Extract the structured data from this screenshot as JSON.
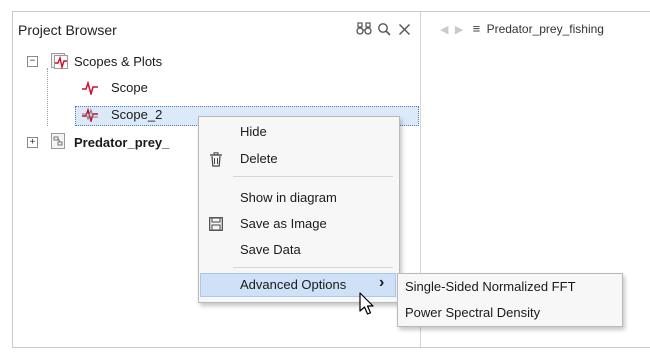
{
  "panel": {
    "title": "Project Browser",
    "icons": [
      "binoculars-icon",
      "search-icon",
      "close-icon"
    ]
  },
  "tree": {
    "items": [
      {
        "label": "Scopes & Plots",
        "expander": "−",
        "icon": "scopes-folder-icon"
      },
      {
        "label": "Scope",
        "icon": "scope-icon"
      },
      {
        "label": "Scope_2",
        "icon": "scope-icon",
        "selected": true
      },
      {
        "label": "Predator_prey_",
        "expander": "+",
        "icon": "model-icon"
      }
    ]
  },
  "right_pane": {
    "title": "Predator_prey_fishing",
    "icons": [
      "back-arrow-icon",
      "forward-arrow-icon",
      "list-icon"
    ]
  },
  "context_menu": {
    "items": [
      {
        "label": "Hide"
      },
      {
        "label": "Delete",
        "icon": "trash-icon"
      },
      {
        "label": "Show in diagram"
      },
      {
        "label": "Save as Image",
        "icon": "floppy-disk-icon"
      },
      {
        "label": "Save Data"
      },
      {
        "label": "Advanced Options",
        "submenu_arrow": "›",
        "highlighted": true
      }
    ]
  },
  "submenu": {
    "items": [
      {
        "label": "Single-Sided Normalized FFT"
      },
      {
        "label": "Power Spectral Density"
      }
    ]
  },
  "colors": {
    "selection_bg": "#dbe9f9",
    "menu_highlight": "#cfe1f7",
    "scope_icon_red": "#c8102e",
    "border": "#c9c9c9"
  }
}
